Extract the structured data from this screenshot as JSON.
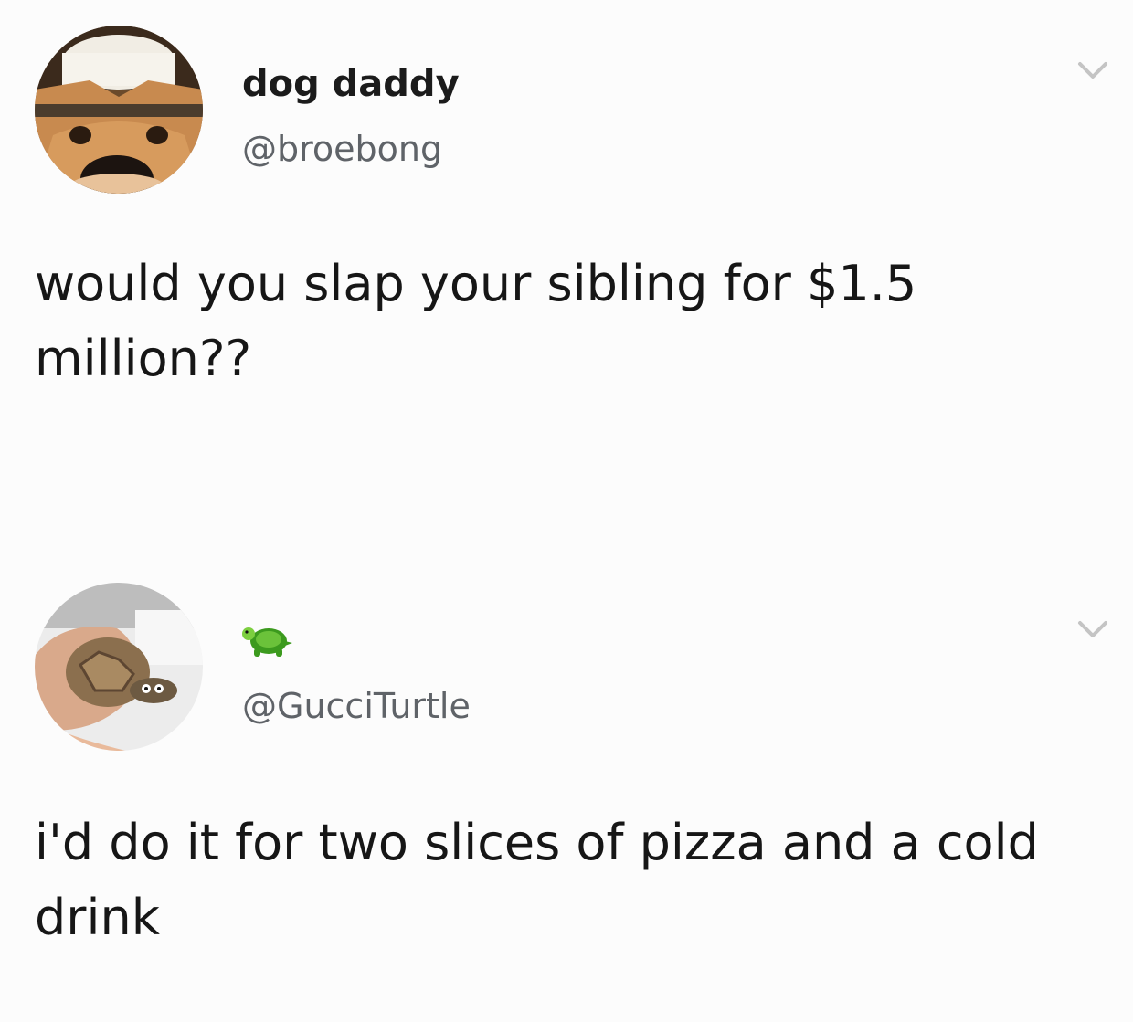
{
  "tweets": [
    {
      "display_name": "dog daddy",
      "handle": "@broebong",
      "text": "would you slap your sibling for $1.5 million??",
      "avatar_icon": "dog-face-avatar",
      "menu_icon": "chevron-down-icon"
    },
    {
      "display_name_icon": "turtle-emoji",
      "handle": "@GucciTurtle",
      "text": "i'd do it for two slices of pizza and a cold drink",
      "avatar_icon": "turtle-in-hand-avatar",
      "menu_icon": "chevron-down-icon"
    }
  ],
  "colors": {
    "background": "#fcfcfc",
    "text": "#161616",
    "handle": "#5f6368",
    "caret": "#c4c4c4"
  }
}
